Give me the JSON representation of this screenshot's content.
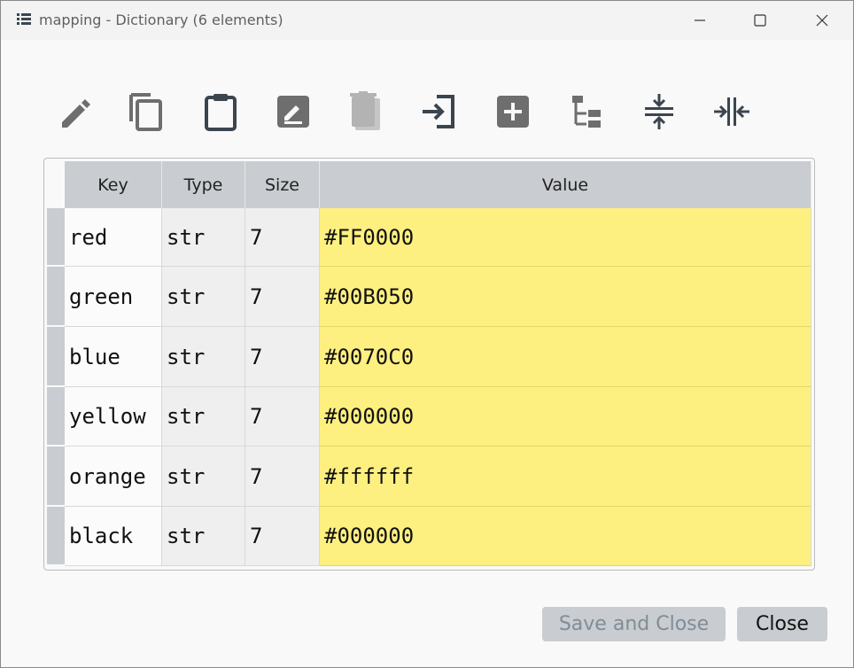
{
  "window": {
    "title": "mapping - Dictionary (6 elements)"
  },
  "toolbar": {
    "buttons": [
      {
        "icon": "pencil-icon",
        "enabled": true
      },
      {
        "icon": "copy-icon",
        "enabled": true
      },
      {
        "icon": "clipboard-icon",
        "enabled": true
      },
      {
        "icon": "edit-box-icon",
        "enabled": true
      },
      {
        "icon": "delete-icon",
        "enabled": false
      },
      {
        "icon": "import-icon",
        "enabled": true
      },
      {
        "icon": "add-icon",
        "enabled": true
      },
      {
        "icon": "tree-icon",
        "enabled": true
      },
      {
        "icon": "collapse-rows-icon",
        "enabled": true
      },
      {
        "icon": "collapse-columns-icon",
        "enabled": true
      }
    ]
  },
  "table": {
    "headers": {
      "key": "Key",
      "type": "Type",
      "size": "Size",
      "value": "Value"
    },
    "rows": [
      {
        "key": "red",
        "type": "str",
        "size": "7",
        "value": "#FF0000"
      },
      {
        "key": "green",
        "type": "str",
        "size": "7",
        "value": "#00B050"
      },
      {
        "key": "blue",
        "type": "str",
        "size": "7",
        "value": "#0070C0"
      },
      {
        "key": "yellow",
        "type": "str",
        "size": "7",
        "value": "#000000"
      },
      {
        "key": "orange",
        "type": "str",
        "size": "7",
        "value": "#ffffff"
      },
      {
        "key": "black",
        "type": "str",
        "size": "7",
        "value": "#000000"
      }
    ]
  },
  "footer": {
    "save_label": "Save and Close",
    "close_label": "Close"
  },
  "colors": {
    "value_cell": "#fef080",
    "header": "#c9ccd0",
    "icon": "#3b4550"
  }
}
